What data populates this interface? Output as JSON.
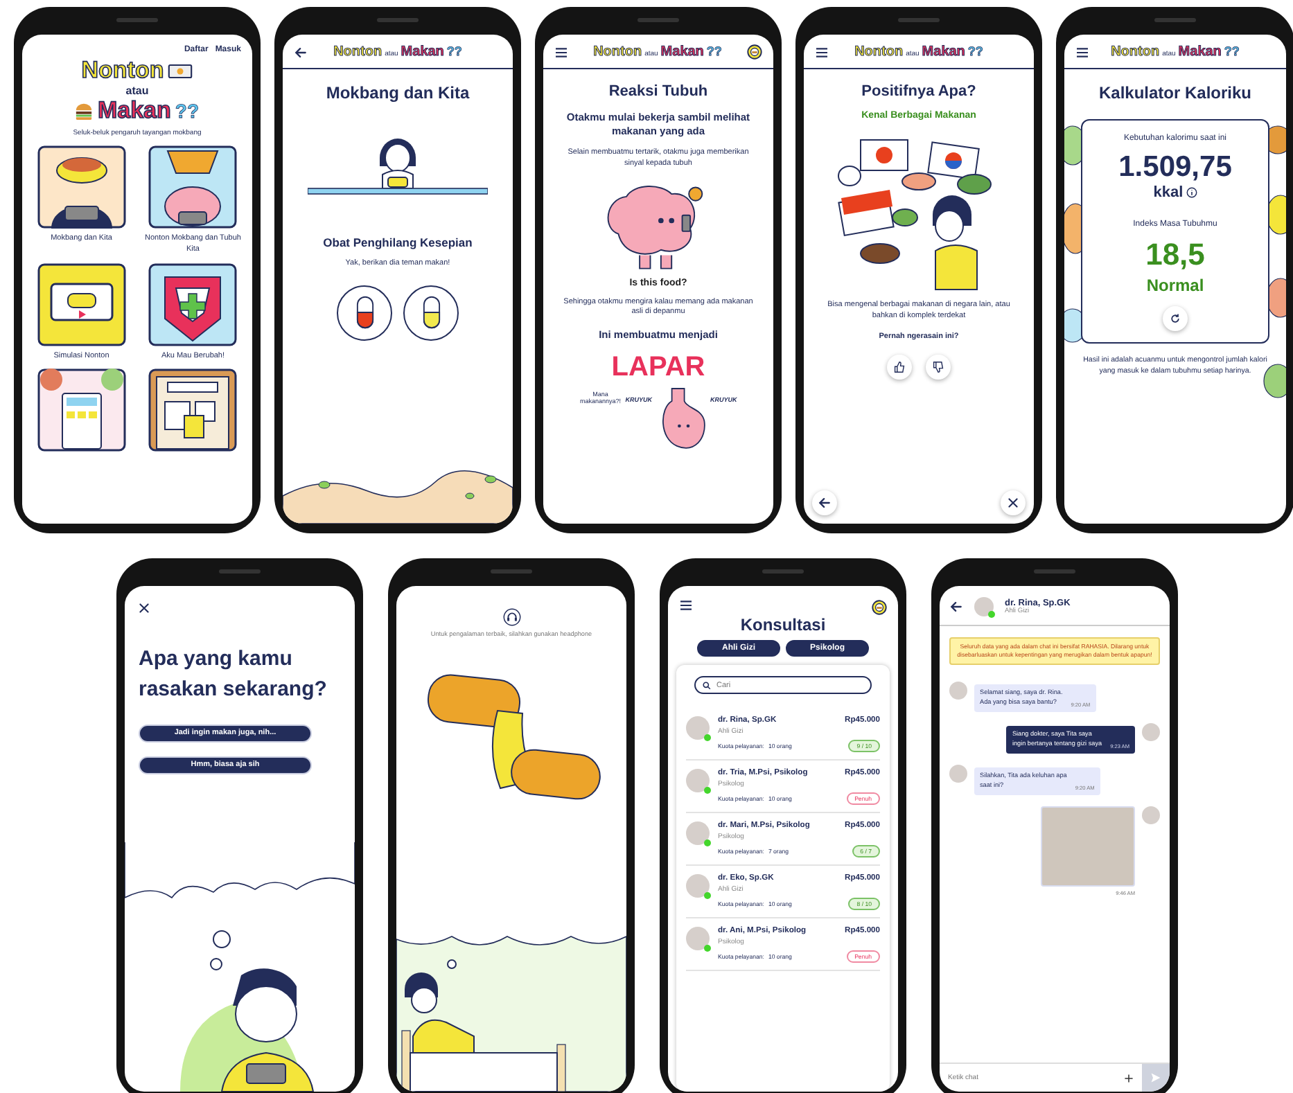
{
  "screens": [
    {
      "kind": "home",
      "nav": [
        {
          "label": "Daftar"
        },
        {
          "label": "Masuk"
        }
      ],
      "logo": {
        "word1": "Nonton",
        "joiner": "atau",
        "word2": "Makan",
        "marks": "??"
      },
      "tagline": "Seluk-beluk pengaruh tayangan mokbang",
      "cards": [
        {
          "kind": "noodles",
          "label": "Mokbang dan Kita"
        },
        {
          "kind": "brain",
          "label": "Nonton Mokbang dan Tubuh Kita"
        },
        {
          "kind": "game",
          "label": "Simulasi Nonton"
        },
        {
          "kind": "hero",
          "label": "Aku Mau Berubah!"
        },
        {
          "kind": "calculator"
        },
        {
          "kind": "board"
        }
      ]
    },
    {
      "kind": "story",
      "header": {
        "nav": {
          "kind": "back"
        }
      },
      "logo": {
        "word1": "Nonton",
        "joiner": "atau",
        "word2": "Makan",
        "marks": "??"
      },
      "title": "Mokbang dan Kita",
      "subtitle": "Obat Penghilang Kesepian",
      "prompt": "Yak, berikan dia teman makan!",
      "pills": [
        {
          "color": "#e8401e"
        },
        {
          "color": "#f2e94e"
        }
      ]
    },
    {
      "kind": "article",
      "header": {
        "nav": {
          "kind": "menu"
        },
        "coin": true
      },
      "logo": {
        "word1": "Nonton",
        "joiner": "atau",
        "word2": "Makan",
        "marks": "??"
      },
      "title": "Reaksi Tubuh",
      "lead": "Otakmu mulai bekerja sambil melihat makanan yang ada",
      "intro": "Selain membuatmu tertarik, otakmu juga memberikan sinyal kepada tubuh",
      "brain_caption": "Is this food?",
      "follow": "Sehingga otakmu mengira kalau memang ada makanan asli di depanmu",
      "result_lead": "Ini membuatmu menjadi",
      "result": "LAPAR",
      "stomach_speech": "Mana makanannya?!",
      "sounds": [
        "KRUYUK",
        "KRUYUK"
      ]
    },
    {
      "kind": "positive",
      "header": {
        "nav": {
          "kind": "menu"
        }
      },
      "logo": {
        "word1": "Nonton",
        "joiner": "atau",
        "word2": "Makan",
        "marks": "??"
      },
      "title": "Positifnya Apa?",
      "subtitle": "Kenal Berbagai Makanan",
      "body": "Bisa mengenal berbagai makanan di negara lain, atau bahkan di komplek terdekat",
      "question": "Pernah ngerasain ini?"
    },
    {
      "kind": "calculator",
      "header": {
        "nav": {
          "kind": "menu"
        }
      },
      "logo": {
        "word1": "Nonton",
        "joiner": "atau",
        "word2": "Makan",
        "marks": "??"
      },
      "title": "Kalkulator Kaloriku",
      "need_label": "Kebutuhan kalorimu saat ini",
      "calories": "1.509,75",
      "unit": "kkal",
      "bmi_label": "Indeks Masa Tubuhmu",
      "bmi": "18,5",
      "bmi_status": "Normal",
      "note": "Hasil ini adalah acuanmu untuk mengontrol jumlah kalori yang masuk ke dalam tubuhmu setiap harinya."
    },
    {
      "kind": "question",
      "question": "Apa yang kamu rasakan sekarang?",
      "options": [
        {
          "label": "Jadi ingin makan juga, nih..."
        },
        {
          "label": "Hmm, biasa aja sih"
        }
      ]
    },
    {
      "kind": "simulation",
      "hint": "Untuk pengalaman terbaik, silahkan gunakan headphone"
    },
    {
      "kind": "consult",
      "header": {
        "nav": {
          "kind": "menu"
        },
        "coin": true
      },
      "title": "Konsultasi",
      "filters": [
        {
          "label": "Ahli Gizi",
          "selected": true
        },
        {
          "label": "Psikolog",
          "selected": true
        }
      ],
      "search": {
        "placeholder": "Cari"
      },
      "doctors": [
        {
          "name": "dr. Rina, Sp.GK",
          "role": "Ahli Gizi",
          "quota_label": "Kuota pelayanan:",
          "quota": "10 orang",
          "price": "Rp45.000",
          "full": false,
          "badge": "9 / 10",
          "online": true
        },
        {
          "name": "dr. Tria, M.Psi, Psikolog",
          "role": "Psikolog",
          "quota_label": "Kuota pelayanan:",
          "quota": "10 orang",
          "price": "Rp45.000",
          "full": true,
          "badge": "Penuh",
          "online": true
        },
        {
          "name": "dr. Mari, M.Psi, Psikolog",
          "role": "Psikolog",
          "quota_label": "Kuota pelayanan:",
          "quota": "7 orang",
          "price": "Rp45.000",
          "full": false,
          "badge": "6 / 7",
          "online": true
        },
        {
          "name": "dr. Eko, Sp.GK",
          "role": "Ahli Gizi",
          "quota_label": "Kuota pelayanan:",
          "quota": "10 orang",
          "price": "Rp45.000",
          "full": false,
          "badge": "8 / 10",
          "online": true
        },
        {
          "name": "dr. Ani, M.Psi, Psikolog",
          "role": "Psikolog",
          "quota_label": "Kuota pelayanan:",
          "quota": "10 orang",
          "price": "Rp45.000",
          "full": true,
          "badge": "Penuh",
          "online": true
        }
      ]
    },
    {
      "kind": "chat",
      "contact": {
        "name": "dr. Rina, Sp.GK",
        "role": "Ahli Gizi",
        "online": true
      },
      "notice": "Seluruh data yang ada dalam chat ini bersifat RAHASIA. Dilarang untuk disebarluaskan untuk kepentingan yang merugikan dalam bentuk apapun!",
      "messages": [
        {
          "mine": false,
          "kind": "text",
          "text": "Selamat siang, saya dr. Rina.\nAda yang bisa saya bantu?",
          "time": "9:20 AM"
        },
        {
          "mine": true,
          "kind": "text",
          "text": "Siang dokter, saya Tita saya\ningin bertanya tentang gizi saya",
          "time": "9:23 AM"
        },
        {
          "mine": false,
          "kind": "text",
          "text": "Silahkan, Tita ada keluhan apa\nsaat ini?",
          "time": "9:20 AM"
        },
        {
          "mine": true,
          "kind": "photo",
          "time": "9:46 AM"
        }
      ],
      "input": {
        "placeholder": "Ketik chat"
      }
    }
  ]
}
